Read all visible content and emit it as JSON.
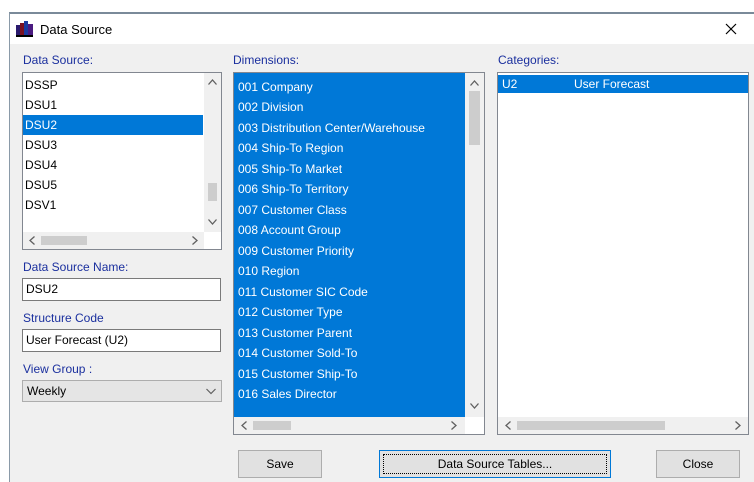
{
  "window": {
    "title": "Data Source"
  },
  "labels": {
    "data_source": "Data Source:",
    "dimensions": "Dimensions:",
    "categories": "Categories:",
    "data_source_name": "Data Source Name:",
    "structure_code": "Structure Code",
    "view_group": "View Group :"
  },
  "data_sources": {
    "items": [
      "DSSP",
      "DSU1",
      "DSU2",
      "DSU3",
      "DSU4",
      "DSU5",
      "DSV1"
    ],
    "selected": "DSU2"
  },
  "fields": {
    "data_source_name": "DSU2",
    "structure_code": "User Forecast (U2)",
    "view_group": "Weekly"
  },
  "dimensions": [
    "001 Company",
    "002 Division",
    "003 Distribution Center/Warehouse",
    "004 Ship-To Region",
    "005 Ship-To Market",
    "006 Ship-To Territory",
    "007 Customer Class",
    "008 Account Group",
    "009 Customer Priority",
    "010 Region",
    "011 Customer SIC Code",
    "012 Customer Type",
    "013 Customer Parent",
    "014 Customer Sold-To",
    "015 Customer Ship-To",
    "016 Sales Director"
  ],
  "categories": [
    {
      "code": "U2",
      "name": "User Forecast"
    }
  ],
  "buttons": {
    "save": "Save",
    "data_source_tables": "Data Source Tables...",
    "close": "Close"
  },
  "colors": {
    "selection": "#0078d7",
    "label": "#1a2f9e"
  }
}
